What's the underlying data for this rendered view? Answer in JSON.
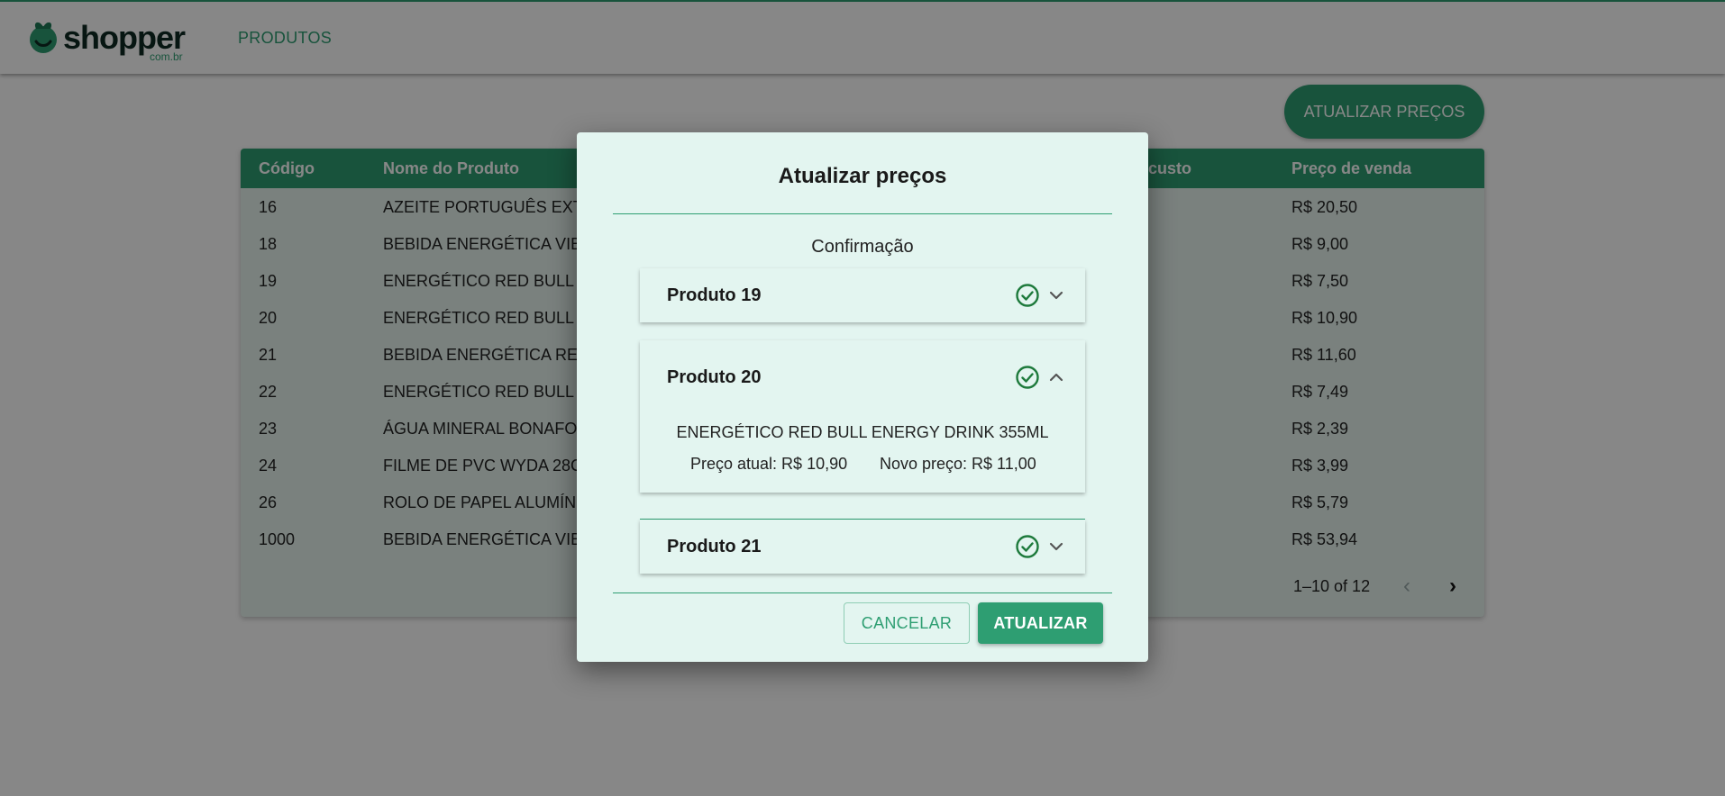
{
  "header": {
    "logo_text": "shopper",
    "logo_sub": "com.br",
    "nav_label": "PRODUTOS"
  },
  "actions": {
    "update_prices_label": "ATUALIZAR PREÇOS"
  },
  "table": {
    "columns": [
      "Código",
      "Nome do Produto",
      "e custo",
      "Preço de venda"
    ],
    "rows": [
      {
        "code": "16",
        "name": "AZEITE PORTUGUÊS EXT",
        "cost": "",
        "sale": "R$ 20,50"
      },
      {
        "code": "18",
        "name": "BEBIDA ENERGÉTICA VIB",
        "cost": "",
        "sale": "R$ 9,00"
      },
      {
        "code": "19",
        "name": "ENERGÉTICO RED BULL",
        "cost": "",
        "sale": "R$ 7,50"
      },
      {
        "code": "20",
        "name": "ENERGÉTICO RED BULL",
        "cost": "",
        "sale": "R$ 10,90"
      },
      {
        "code": "21",
        "name": "BEBIDA ENERGÉTICA RE",
        "cost": "",
        "sale": "R$ 11,60"
      },
      {
        "code": "22",
        "name": "ENERGÉTICO RED BULL",
        "cost": "",
        "sale": "R$ 7,49"
      },
      {
        "code": "23",
        "name": "ÁGUA MINERAL BONAFO",
        "cost": "",
        "sale": "R$ 2,39"
      },
      {
        "code": "24",
        "name": "FILME DE PVC WYDA 28C",
        "cost": "",
        "sale": "R$ 3,99"
      },
      {
        "code": "26",
        "name": "ROLO DE PAPEL ALUMÍN",
        "cost": "",
        "sale": "R$ 5,79"
      },
      {
        "code": "1000",
        "name": "BEBIDA ENERGÉTICA VIB",
        "cost": "",
        "sale": "R$ 53,94"
      }
    ],
    "pagination": {
      "range_label": "1–10 of 12",
      "prev_icon": "chevron-left-icon",
      "next_icon": "chevron-right-icon"
    }
  },
  "modal": {
    "title": "Atualizar preços",
    "subtitle": "Confirmação",
    "items": [
      {
        "title": "Produto 19",
        "expanded": false,
        "status_icon": "check-circle-icon"
      },
      {
        "title": "Produto 20",
        "expanded": true,
        "status_icon": "check-circle-icon",
        "description": "ENERGÉTICO RED BULL ENERGY DRINK 355ML",
        "current_price": "Preço atual: R$ 10,90",
        "new_price": "Novo preço: R$ 11,00"
      },
      {
        "title": "Produto 21",
        "expanded": false,
        "status_icon": "check-circle-icon"
      }
    ],
    "cancel_label": "CANCELAR",
    "confirm_label": "ATUALIZAR"
  },
  "colors": {
    "brand": "#2e9e72",
    "modal_bg": "#e3f5f0",
    "check": "#1e7a3c"
  }
}
